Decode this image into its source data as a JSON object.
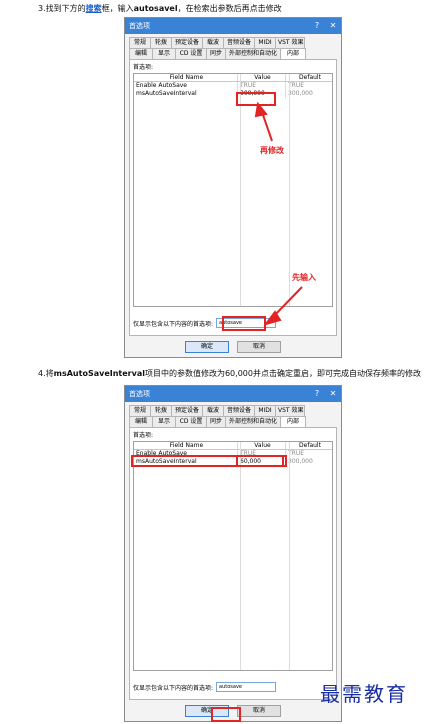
{
  "step3": {
    "prefix": "3.找到下方的",
    "highlight": "搜索",
    "middle": "框，输入",
    "keyword": "autosavel",
    "suffix": "，在检索出参数后再点击修改"
  },
  "step4": {
    "prefix": "4.将",
    "keyword": "msAutoSaveInterval",
    "suffix": "项目中的参数值修改为60,000并点击确定重启，即可完成自动保存频率的修改"
  },
  "dialog": {
    "title": "首选项",
    "help_glyph": "?",
    "close_glyph": "✕",
    "tabs_row1": [
      "常规",
      "轮拨",
      "预定设备",
      "载波",
      "音频设备",
      "MIDI",
      "VST 效果"
    ],
    "tabs_row2": [
      "编辑",
      "显示",
      "CD 设置",
      "同步",
      "外部控制和自动化",
      "内部"
    ],
    "panel_label": "首选项:",
    "columns": [
      "Field Name",
      "Value",
      "Default"
    ],
    "rows": [
      {
        "name": "Enable AutoSave",
        "default": "TRUE"
      },
      {
        "name": "msAutoSaveInterval",
        "default": "300,000"
      }
    ],
    "filter_label": "仅显示包含以下内容的首选项:",
    "ok": "确定",
    "cancel": "取消"
  },
  "dialog1": {
    "values": [
      "TRUE",
      "300,000"
    ],
    "filter_value": "autosave"
  },
  "dialog2": {
    "values": [
      "TRUE",
      "60,000"
    ],
    "filter_value": "autosave"
  },
  "annotations": {
    "modify_again": "再修改",
    "input_first": "先输入"
  },
  "watermark": "最需教育",
  "colors": {
    "annotation_red": "#e22424",
    "title_blue": "#3a82d6"
  }
}
